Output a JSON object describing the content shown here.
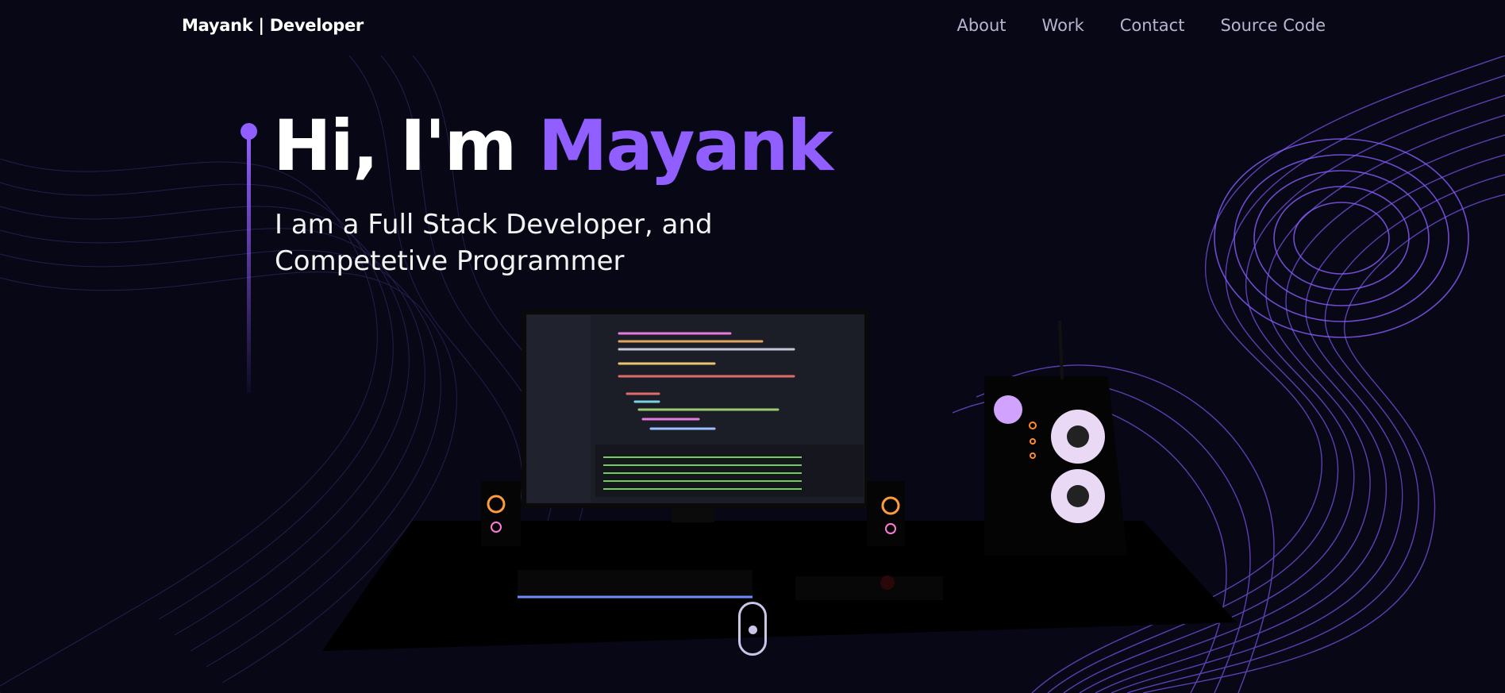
{
  "nav": {
    "brand": "Mayank | Developer",
    "links": [
      "About",
      "Work",
      "Contact",
      "Source Code"
    ]
  },
  "hero": {
    "greeting": "Hi, I'm ",
    "name": "Mayank",
    "subtitle_line1": "I am a Full Stack Developer, and",
    "subtitle_line2": "Competetive Programmer"
  },
  "colors": {
    "background": "#070716",
    "accent": "#915eff",
    "nav_text": "#b7b4cf",
    "text": "#ffffff"
  },
  "icons": {
    "scroll_indicator": "mouse-scroll-icon"
  }
}
